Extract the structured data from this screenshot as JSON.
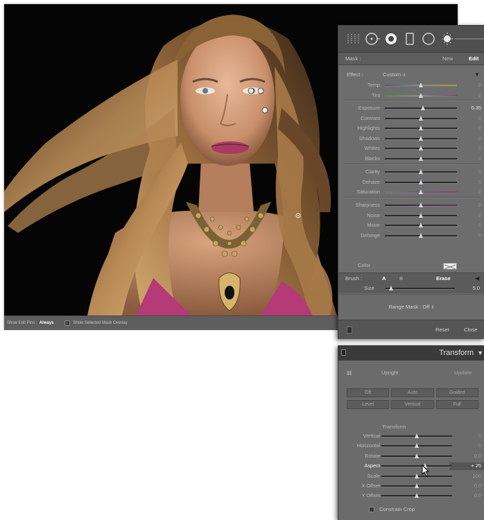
{
  "photo_toolbar": {
    "show_pins_label": "Show Edit Pins :",
    "show_pins_value": "Always",
    "overlay_label": "Show Selected Mask Overlay"
  },
  "mask_panel": {
    "mask_label": "Mask :",
    "new_label": "New",
    "edit_label": "Edit",
    "effect_label": "Effect :",
    "effect_value": "Custom",
    "effect_chevron": "⇕",
    "sliders_group1": [
      {
        "label": "Temp",
        "value": "0",
        "pos": 0.5
      },
      {
        "label": "Tint",
        "value": "0",
        "pos": 0.5
      }
    ],
    "sliders_group2": [
      {
        "label": "Exposure",
        "value": "0.35",
        "pos": 0.53
      },
      {
        "label": "Contrast",
        "value": "0",
        "pos": 0.5
      },
      {
        "label": "Highlights",
        "value": "0",
        "pos": 0.5
      },
      {
        "label": "Shadows",
        "value": "0",
        "pos": 0.5
      },
      {
        "label": "Whites",
        "value": "0",
        "pos": 0.5
      },
      {
        "label": "Blacks",
        "value": "0",
        "pos": 0.5
      }
    ],
    "sliders_group3": [
      {
        "label": "Clarity",
        "value": "0",
        "pos": 0.5
      },
      {
        "label": "Dehaze",
        "value": "0",
        "pos": 0.5
      },
      {
        "label": "Saturation",
        "value": "0",
        "pos": 0.5
      }
    ],
    "sliders_group4": [
      {
        "label": "Sharpness",
        "value": "0",
        "pos": 0.5
      },
      {
        "label": "Noise",
        "value": "0",
        "pos": 0.5
      },
      {
        "label": "Moire",
        "value": "0",
        "pos": 0.5
      },
      {
        "label": "Defringe",
        "value": "0",
        "pos": 0.5
      }
    ],
    "color_label": "Color",
    "brush_label": "Brush :",
    "brush_a": "A",
    "brush_b": "B",
    "brush_erase": "Erase",
    "size_label": "Size",
    "size_value": "5.0",
    "size_pos": 0.05,
    "range_mask_label": "Range Mask : Off",
    "reset_label": "Reset",
    "close_label": "Close"
  },
  "transform_panel": {
    "title": "Transform",
    "upright_label": "Upright",
    "update_label": "Update",
    "buttons_row1": [
      "Off",
      "Auto",
      "Guided"
    ],
    "buttons_row2": [
      "Level",
      "Vertical",
      "Full"
    ],
    "transform_sub_label": "Transform",
    "sliders": [
      {
        "label": "Vertical",
        "value": "0",
        "pos": 0.5
      },
      {
        "label": "Horizontal",
        "value": "0",
        "pos": 0.5
      },
      {
        "label": "Rotate",
        "value": "0.0",
        "pos": 0.5
      },
      {
        "label": "Aspect",
        "value": "+ 25",
        "pos": 0.62
      },
      {
        "label": "Scale",
        "value": "100",
        "pos": 0.5
      },
      {
        "label": "X Offset",
        "value": "0.0",
        "pos": 0.5
      },
      {
        "label": "Y Offset",
        "value": "0.0",
        "pos": 0.5
      }
    ],
    "constrain_label": "Constrain Crop"
  },
  "icons": [
    "graduated-filter-icon",
    "radial-filter-icon",
    "adjustment-brush-icon",
    "spot-removal-icon",
    "red-eye-icon",
    "crop-icon",
    "edit-pin-icon"
  ],
  "colors": {
    "panel_bg": "#6b6b6b",
    "panel_dark": "#3a3a3a",
    "photo_bg": "#050505",
    "accent_text": "#ffffff"
  }
}
